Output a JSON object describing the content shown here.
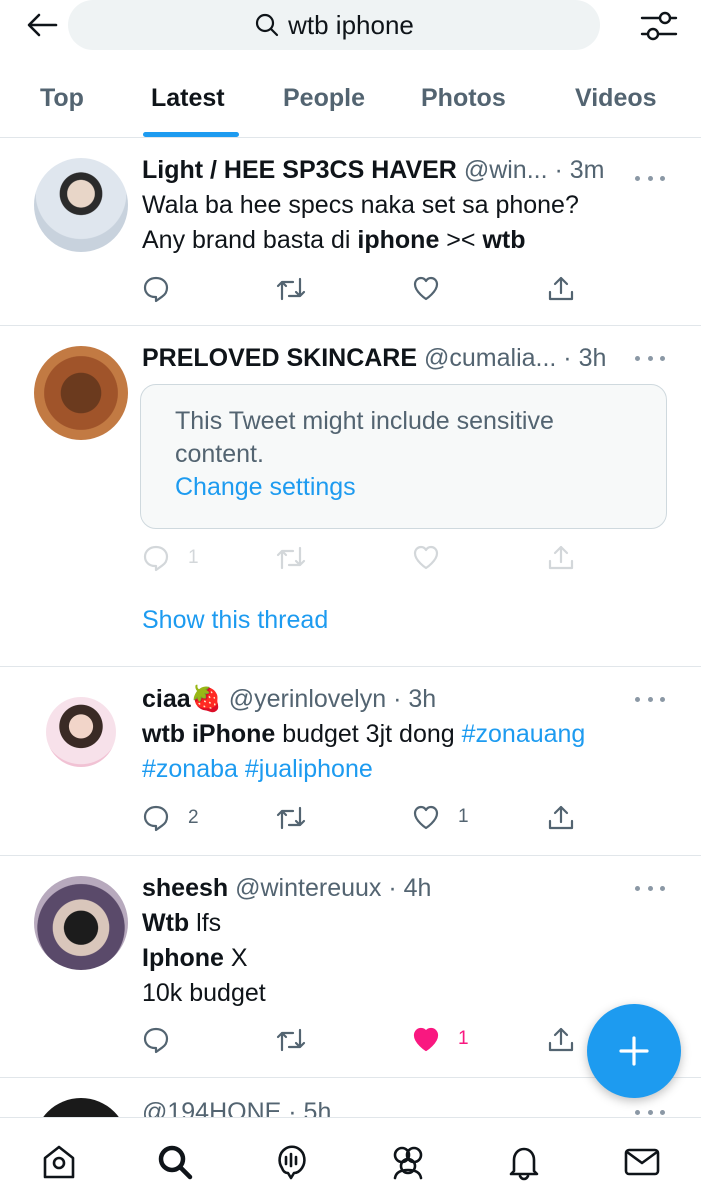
{
  "search": {
    "query": "wtb iphone"
  },
  "tabs": [
    {
      "label": "Top"
    },
    {
      "label": "Latest"
    },
    {
      "label": "People"
    },
    {
      "label": "Photos"
    },
    {
      "label": "Videos"
    }
  ],
  "tweets": [
    {
      "name": "Light / HEE SP3CS HAVER",
      "meta": "@win... · 3m",
      "line1": "Wala ba hee specs naka set sa phone?",
      "line2_a": "Any brand basta di ",
      "line2_b": "iphone",
      "line2_c": " >< ",
      "line2_d": "wtb"
    },
    {
      "name": "PRELOVED SKINCARE",
      "meta": "@cumalia... · 3h",
      "sensitive_text": "This Tweet might include sensitive content.",
      "sensitive_link": "Change settings",
      "reply_count": "1",
      "thread_link": "Show this thread"
    },
    {
      "name": "ciaa🍓",
      "meta": "@yerinlovelyn · 3h",
      "t1_bold": "wtb iPhone",
      "t1_rest": " budget 3jt dong ",
      "t1_tag": "#zonauang",
      "t2_tags": "#zonaba #jualiphone",
      "reply_count": "2",
      "like_count": "1"
    },
    {
      "name": "sheesh",
      "meta": "@wintereuux · 4h",
      "l1_bold": "Wtb",
      "l1_rest": " lfs",
      "l2_bold": "Iphone",
      "l2_rest": " X",
      "l3": "10k budget",
      "like_count": "1"
    },
    {
      "meta": "@194HONE · 5h"
    }
  ],
  "colors": {
    "accent": "#1d9bf0",
    "like": "#f91880",
    "secondary": "#536471"
  },
  "icons": {
    "nav": [
      "home-icon",
      "search-icon",
      "spaces-icon",
      "communities-icon",
      "notifications-icon",
      "messages-icon"
    ]
  }
}
